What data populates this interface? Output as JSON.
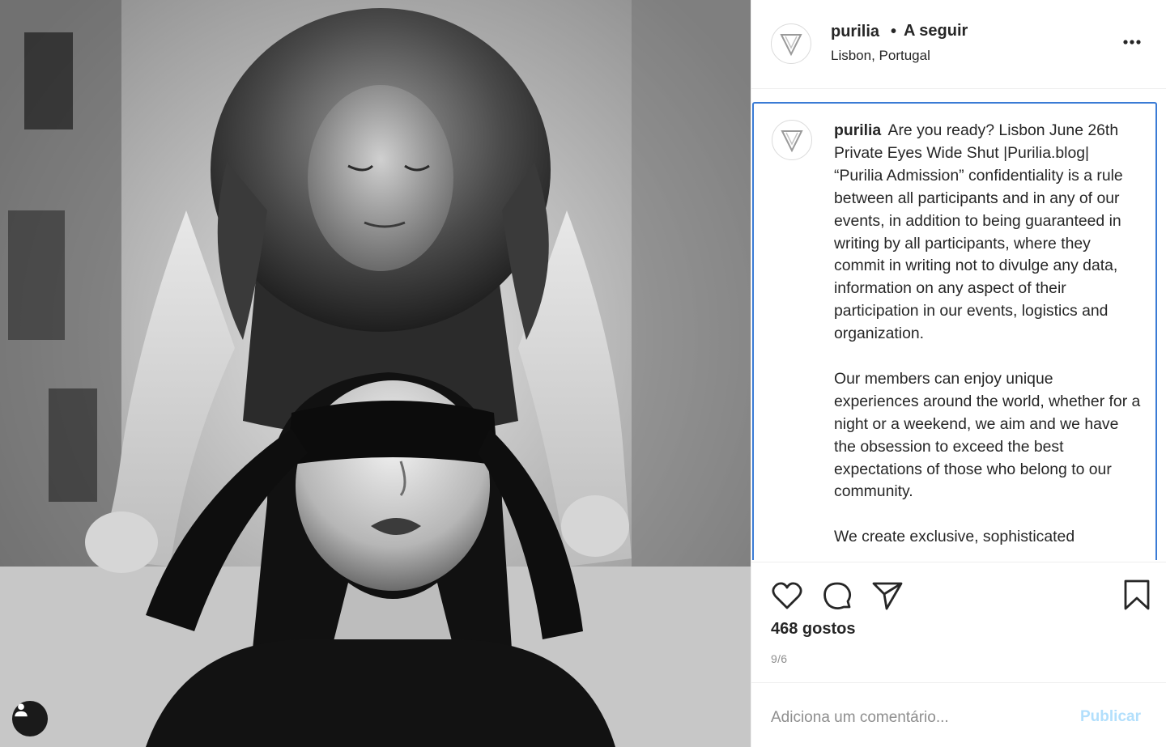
{
  "post": {
    "username": "purilia",
    "follow_dot": "•",
    "follow_label": "A seguir",
    "location": "Lisbon, Portugal",
    "caption": {
      "paragraphs": [
        "Are you ready? Lisbon June 26th Private Eyes Wide Shut |Purilia.blog| “Purilia Admission” confidentiality is a rule between all participants and in any of our events, in addition to being guaranteed in writing by all participants, where they commit in writing not to divulge any data, information on any aspect of their participation in our events, logistics and organization.",
        "Our members can enjoy unique experiences around the world, whether for a night or a weekend, we aim and we have the obsession to exceed the best expectations of those who belong to our community.",
        "We create exclusive, sophisticated"
      ]
    },
    "likes_label": "468 gostos",
    "date_label": "9/6",
    "comment_placeholder": "Adiciona um comentário...",
    "publish_label": "Publicar"
  },
  "icons": {
    "avatar": "purilia-logo-icon",
    "more": "more-options-icon",
    "like": "heart-icon",
    "comment": "comment-bubble-icon",
    "share": "paper-plane-icon",
    "save": "bookmark-icon",
    "user_tag": "user-tag-icon"
  },
  "colors": {
    "caption_border": "#3a7bd5",
    "publish_disabled": "#b2dffc",
    "muted": "#8e8e8e",
    "text": "#262626"
  }
}
